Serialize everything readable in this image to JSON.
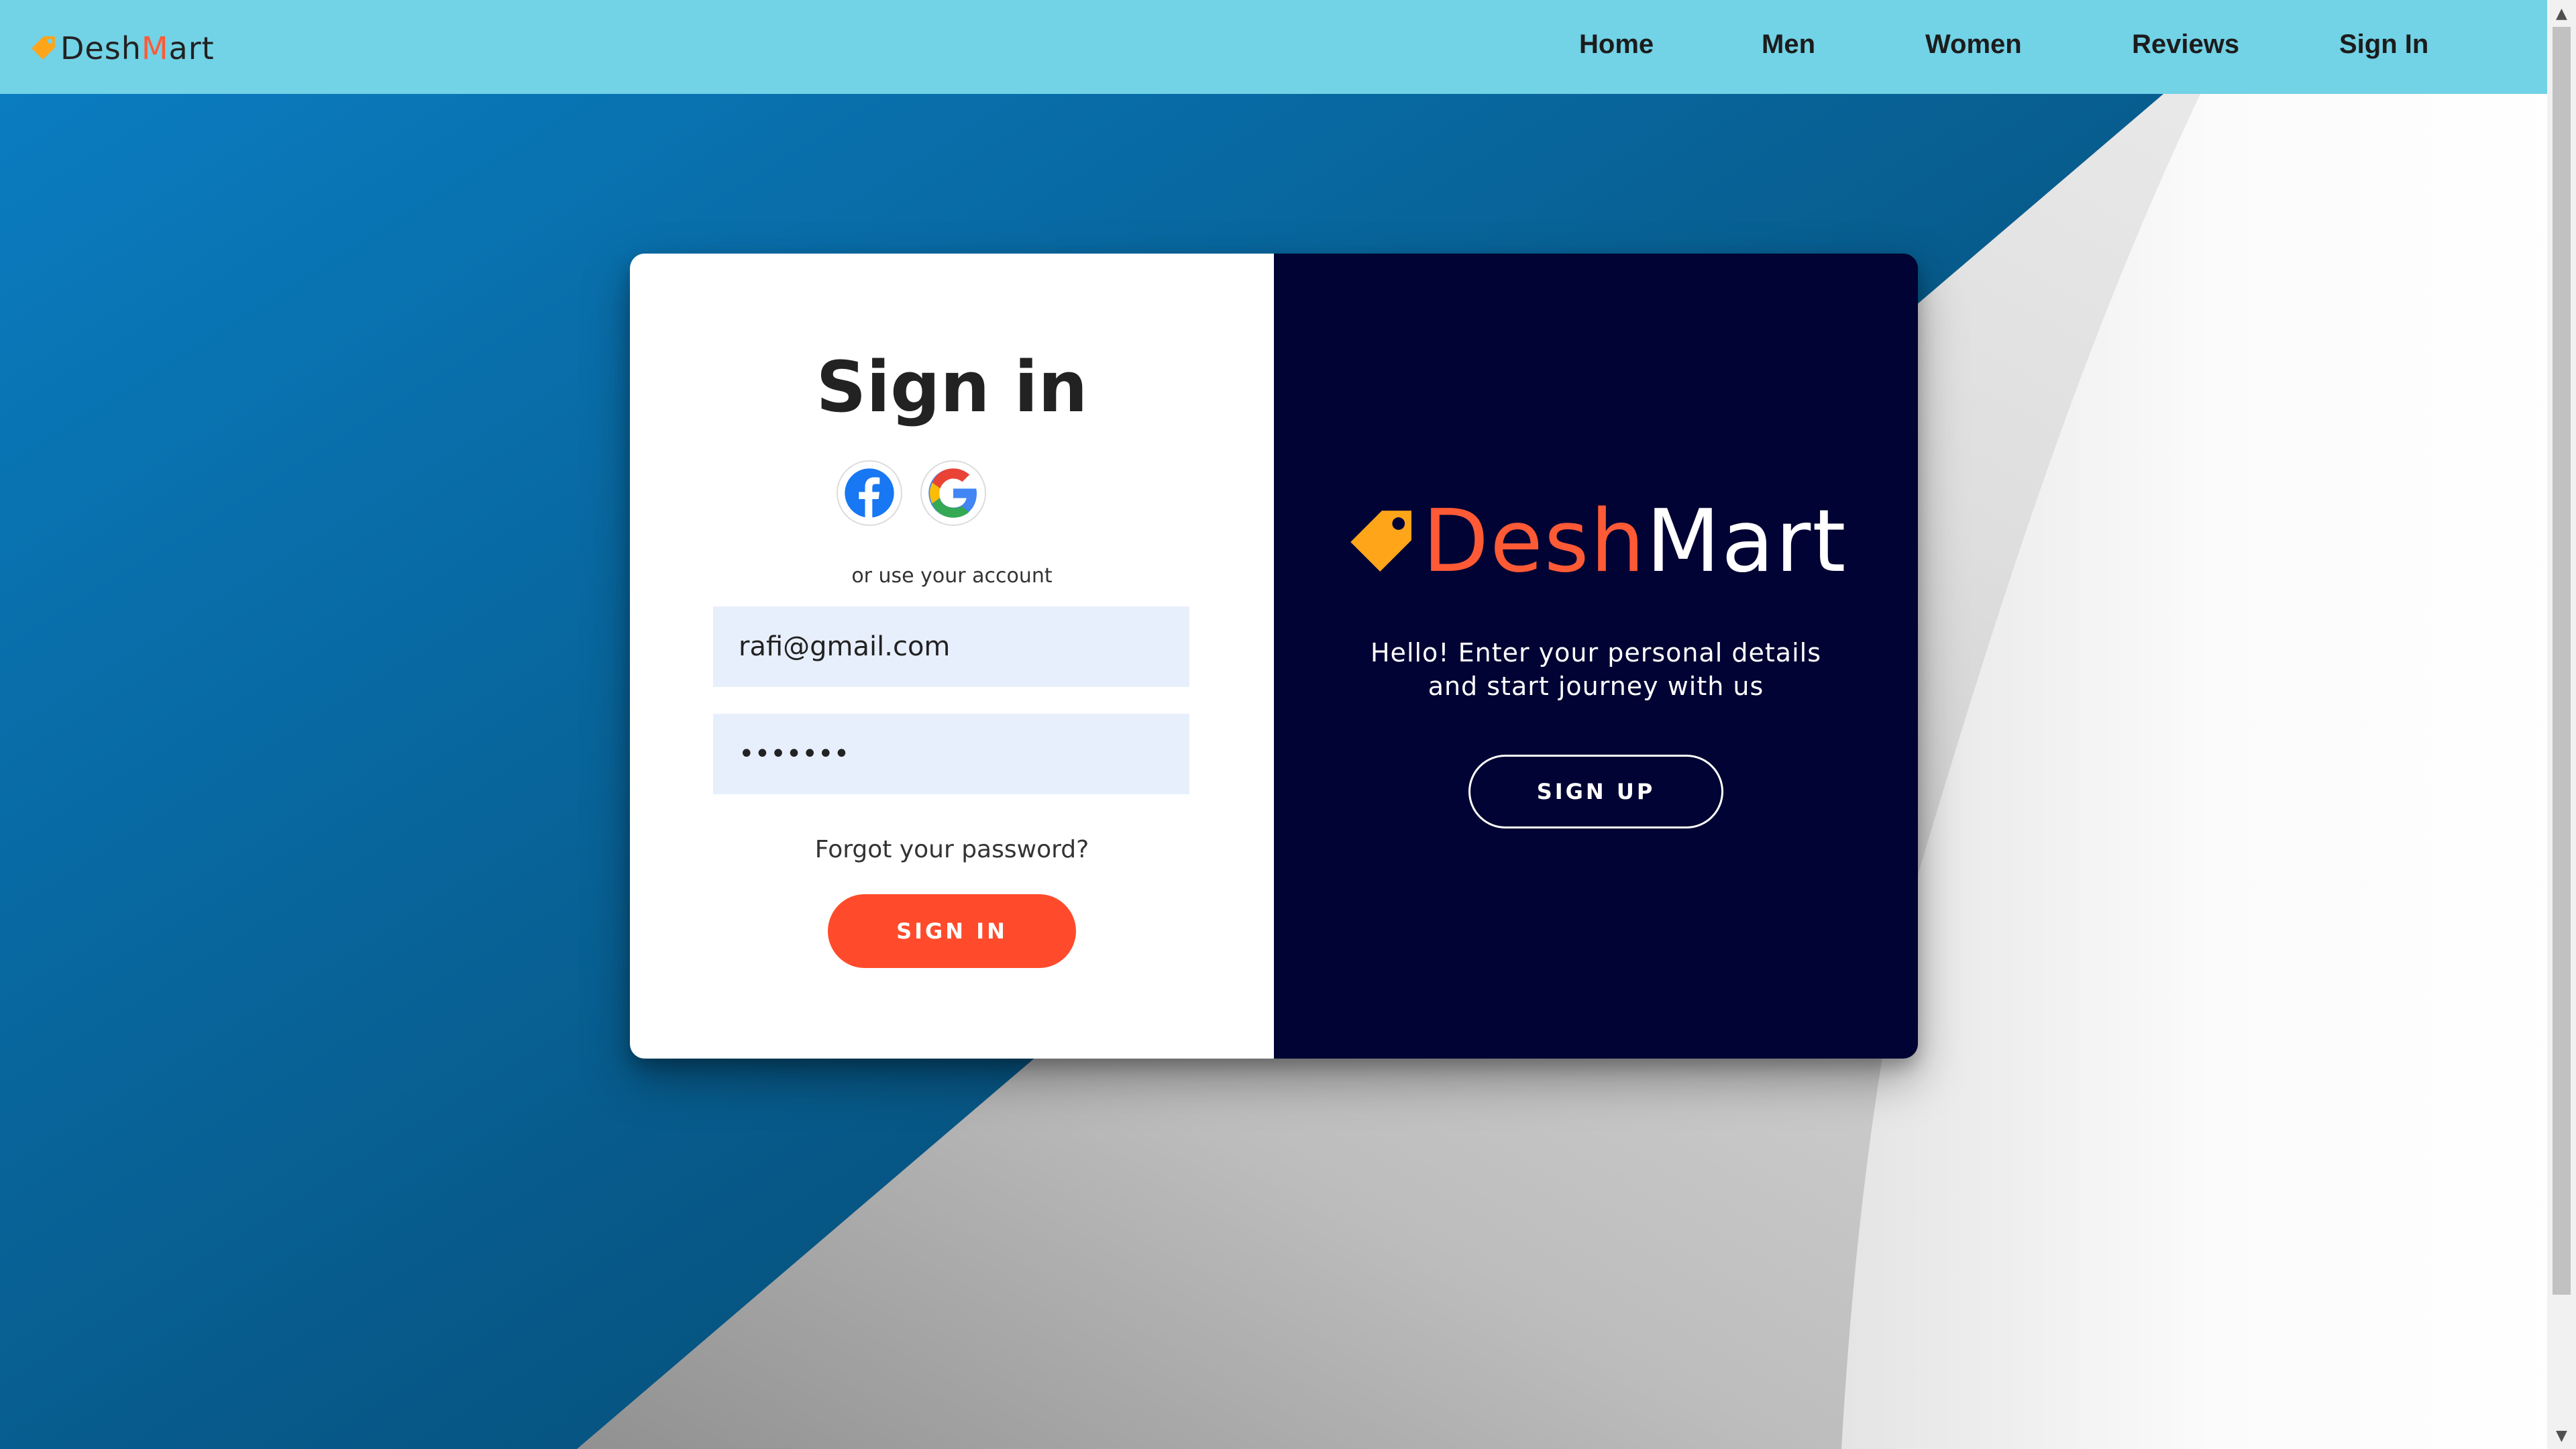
{
  "navbar": {
    "logo": {
      "prefix": "Desh",
      "accent": "M",
      "suffix": "art"
    },
    "items": [
      {
        "label": "Home"
      },
      {
        "label": "Men"
      },
      {
        "label": "Women"
      },
      {
        "label": "Reviews"
      },
      {
        "label": "Sign In"
      }
    ]
  },
  "signin": {
    "title": "Sign in",
    "social": [
      {
        "name": "facebook-icon"
      },
      {
        "name": "google-icon"
      }
    ],
    "or_text": "or use your account",
    "email_value": "rafi@gmail.com",
    "password_value": "•••••••",
    "forgot_label": "Forgot your password?",
    "button_label": "SIGN IN"
  },
  "overlay": {
    "brand": {
      "prefix": "Desh",
      "accent": "M",
      "suffix": "art"
    },
    "tagline": "Hello! Enter your personal details and start journey with us",
    "button_label": "SIGN UP"
  },
  "colors": {
    "navbar": "#72d2e6",
    "accent": "#ff4b2b",
    "panel_dark": "#000333",
    "input_bg": "#e8effc",
    "tag_yellow": "#ffa51a"
  }
}
